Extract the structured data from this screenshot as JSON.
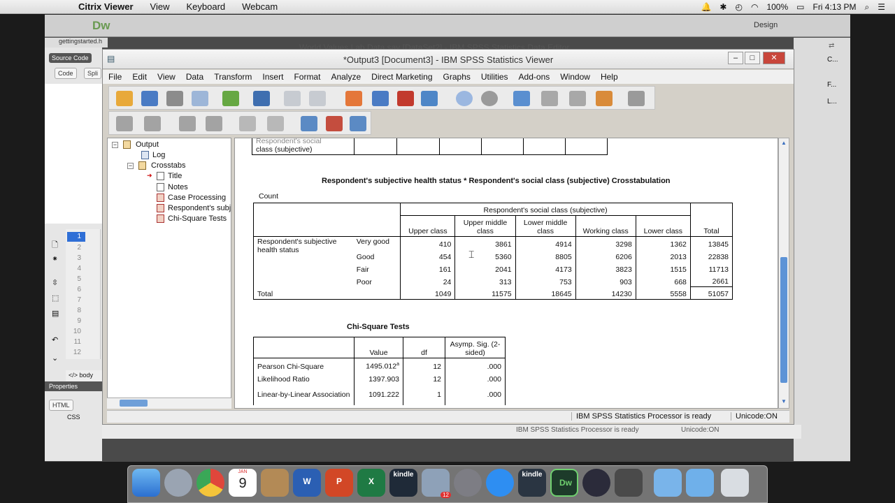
{
  "menubar": {
    "app": "Citrix Viewer",
    "items": [
      "View",
      "Keyboard",
      "Webcam"
    ],
    "battery": "100%",
    "clock": "Fri 4:13 PM"
  },
  "dreamweaver": {
    "logo": "Dw",
    "workspace": "Design",
    "file_tab": "gettingstarted.h",
    "source_code": "Source Code",
    "code_btn": "Code",
    "split_btn": "Spli",
    "line_numbers": [
      "1",
      "2",
      "3",
      "4",
      "5",
      "6",
      "7",
      "8",
      "9",
      "10",
      "11",
      "12"
    ],
    "body_tag": "body",
    "properties": "Properties",
    "html_btn": "HTML",
    "css_btn": "CSS",
    "behind_title": "World Values Lab Data.sav [DataSet2] - IBM SPSS Statistics Data Editor",
    "status_ready": "IBM SPSS Statistics Processor is ready",
    "unicode": "Unicode:ON",
    "right_items": [
      "C...",
      "F...",
      "L..."
    ]
  },
  "window": {
    "title": "*Output3 [Document3] - IBM SPSS Statistics Viewer"
  },
  "menu": [
    "File",
    "Edit",
    "View",
    "Data",
    "Transform",
    "Insert",
    "Format",
    "Analyze",
    "Direct Marketing",
    "Graphs",
    "Utilities",
    "Add-ons",
    "Window",
    "Help"
  ],
  "nav": {
    "output": "Output",
    "log": "Log",
    "crosstabs": "Crosstabs",
    "title": "Title",
    "notes": "Notes",
    "case": "Case Processing",
    "resp": "Respondent's subj",
    "chi": "Chi-Square Tests"
  },
  "prev": {
    "l1": "Respondent's social",
    "l2": "class (subjective)"
  },
  "crosstab": {
    "title": "Respondent's subjective health status * Respondent's social class (subjective) Crosstabulation",
    "count": "Count",
    "group": "Respondent's social class (subjective)",
    "cols": [
      "Upper class",
      "Upper middle class",
      "Lower middle class",
      "Working class",
      "Lower class"
    ],
    "total": "Total",
    "row_var": "Respondent's subjective health status",
    "rows": [
      {
        "label": "Very good",
        "v": [
          "410",
          "3861",
          "4914",
          "3298",
          "1362",
          "13845"
        ]
      },
      {
        "label": "Good",
        "v": [
          "454",
          "5360",
          "8805",
          "6206",
          "2013",
          "22838"
        ]
      },
      {
        "label": "Fair",
        "v": [
          "161",
          "2041",
          "4173",
          "3823",
          "1515",
          "11713"
        ]
      },
      {
        "label": "Poor",
        "v": [
          "24",
          "313",
          "753",
          "903",
          "668",
          "2661"
        ]
      }
    ],
    "total_row": {
      "label": "Total",
      "v": [
        "1049",
        "11575",
        "18645",
        "14230",
        "5558",
        "51057"
      ]
    }
  },
  "chi": {
    "title": "Chi-Square Tests",
    "headers": [
      "Value",
      "df",
      "Asymp. Sig. (2-sided)"
    ],
    "rows": [
      {
        "label": "Pearson Chi-Square",
        "value": "1495.012",
        "sup": "a",
        "df": "12",
        "sig": ".000"
      },
      {
        "label": "Likelihood Ratio",
        "value": "1397.903",
        "df": "12",
        "sig": ".000"
      },
      {
        "label": "Linear-by-Linear Association",
        "value": "1091.222",
        "df": "1",
        "sig": ".000"
      }
    ]
  },
  "status": {
    "ready": "IBM SPSS Statistics Processor is ready",
    "unicode": "Unicode:ON"
  },
  "dock": {
    "calendar_month": "JAN",
    "calendar_day": "9",
    "badge": "12",
    "kindle": "kindle"
  }
}
